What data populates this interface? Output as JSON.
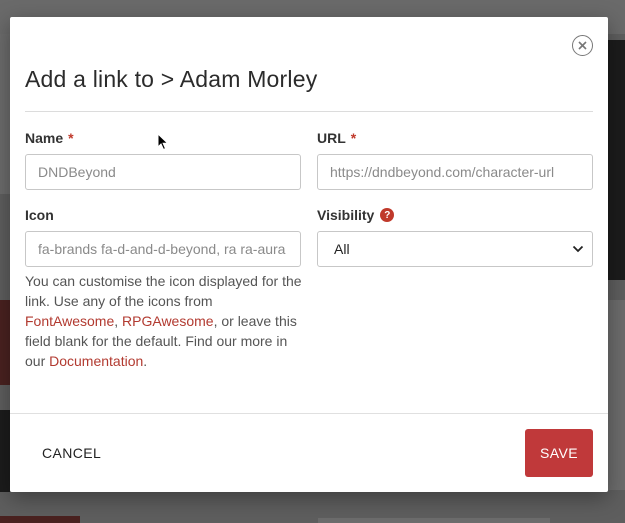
{
  "modal": {
    "title": "Add a link to > Adam Morley",
    "fields": {
      "name": {
        "label": "Name",
        "required_mark": "*",
        "placeholder": "DNDBeyond"
      },
      "url": {
        "label": "URL",
        "required_mark": "*",
        "placeholder": "https://dndbeyond.com/character-url"
      },
      "icon": {
        "label": "Icon",
        "placeholder": "fa-brands fa-d-and-d-beyond, ra ra-aura"
      },
      "visibility": {
        "label": "Visibility",
        "help_glyph": "?",
        "selected": "All"
      }
    },
    "help": {
      "part1": "You can customise the icon displayed for the link. Use any of the icons from ",
      "link_fontawesome": "FontAwesome",
      "sep": ", ",
      "link_rpgawesome": "RPGAwesome",
      "part2": ", or leave this field blank for the default. Find our more in our ",
      "link_docs": "Documentation",
      "end": "."
    },
    "footer": {
      "cancel_label": "CANCEL",
      "save_label": "SAVE"
    }
  },
  "colors": {
    "accent": "#c0393a",
    "link": "#b23a30"
  },
  "icons": {
    "close": "close-circle-icon",
    "chevron": "chevron-down-icon",
    "cursor": "mouse-pointer-icon"
  }
}
